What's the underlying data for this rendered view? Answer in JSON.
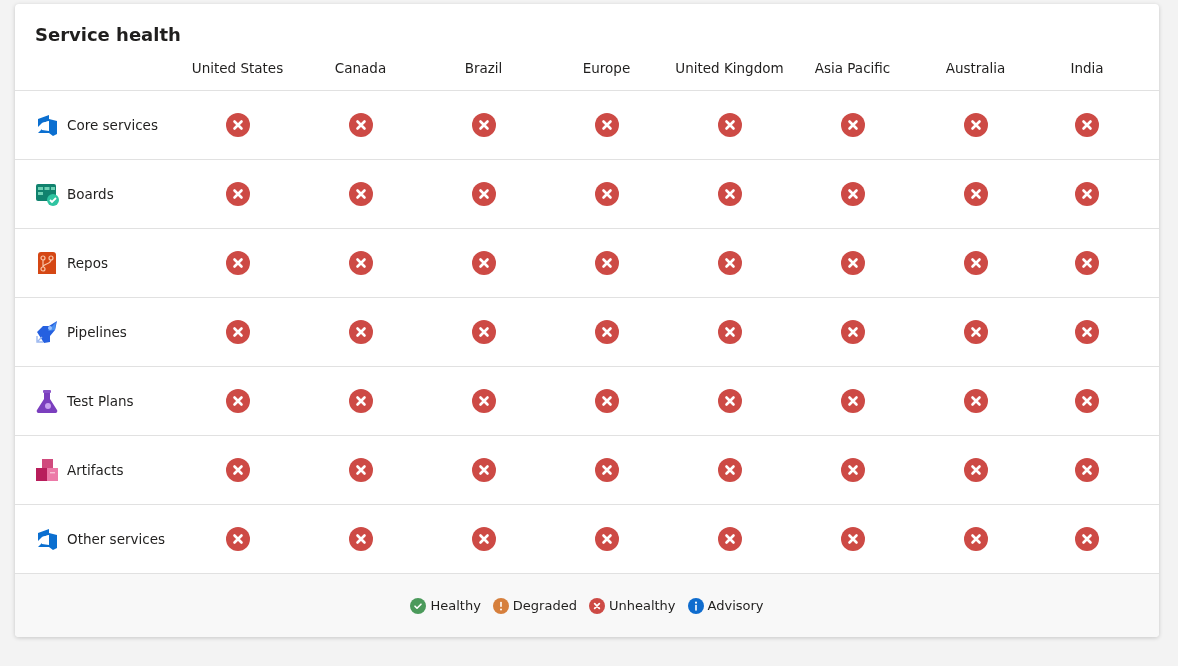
{
  "title": "Service health",
  "regions": [
    "United States",
    "Canada",
    "Brazil",
    "Europe",
    "United Kingdom",
    "Asia Pacific",
    "Australia",
    "India"
  ],
  "services": [
    {
      "name": "Core services",
      "kind": "azure",
      "statuses": [
        {
          "kind": "unhealthy"
        },
        {
          "kind": "unhealthy"
        },
        {
          "kind": "unhealthy"
        },
        {
          "kind": "unhealthy"
        },
        {
          "kind": "unhealthy"
        },
        {
          "kind": "unhealthy"
        },
        {
          "kind": "unhealthy"
        },
        {
          "kind": "unhealthy"
        }
      ]
    },
    {
      "name": "Boards",
      "kind": "boards",
      "statuses": [
        {
          "kind": "unhealthy"
        },
        {
          "kind": "unhealthy"
        },
        {
          "kind": "unhealthy"
        },
        {
          "kind": "unhealthy"
        },
        {
          "kind": "unhealthy"
        },
        {
          "kind": "unhealthy"
        },
        {
          "kind": "unhealthy"
        },
        {
          "kind": "unhealthy"
        }
      ]
    },
    {
      "name": "Repos",
      "kind": "repos",
      "statuses": [
        {
          "kind": "unhealthy"
        },
        {
          "kind": "unhealthy"
        },
        {
          "kind": "unhealthy"
        },
        {
          "kind": "unhealthy"
        },
        {
          "kind": "unhealthy"
        },
        {
          "kind": "unhealthy"
        },
        {
          "kind": "unhealthy"
        },
        {
          "kind": "unhealthy"
        }
      ]
    },
    {
      "name": "Pipelines",
      "kind": "pipelines",
      "statuses": [
        {
          "kind": "unhealthy"
        },
        {
          "kind": "unhealthy"
        },
        {
          "kind": "unhealthy"
        },
        {
          "kind": "unhealthy"
        },
        {
          "kind": "unhealthy"
        },
        {
          "kind": "unhealthy"
        },
        {
          "kind": "unhealthy"
        },
        {
          "kind": "unhealthy"
        }
      ]
    },
    {
      "name": "Test Plans",
      "kind": "testplans",
      "statuses": [
        {
          "kind": "unhealthy"
        },
        {
          "kind": "unhealthy"
        },
        {
          "kind": "unhealthy"
        },
        {
          "kind": "unhealthy"
        },
        {
          "kind": "unhealthy"
        },
        {
          "kind": "unhealthy"
        },
        {
          "kind": "unhealthy"
        },
        {
          "kind": "unhealthy"
        }
      ]
    },
    {
      "name": "Artifacts",
      "kind": "artifacts",
      "statuses": [
        {
          "kind": "unhealthy"
        },
        {
          "kind": "unhealthy"
        },
        {
          "kind": "unhealthy"
        },
        {
          "kind": "unhealthy"
        },
        {
          "kind": "unhealthy"
        },
        {
          "kind": "unhealthy"
        },
        {
          "kind": "unhealthy"
        },
        {
          "kind": "unhealthy"
        }
      ]
    },
    {
      "name": "Other services",
      "kind": "azure",
      "statuses": [
        {
          "kind": "unhealthy"
        },
        {
          "kind": "unhealthy"
        },
        {
          "kind": "unhealthy"
        },
        {
          "kind": "unhealthy"
        },
        {
          "kind": "unhealthy"
        },
        {
          "kind": "unhealthy"
        },
        {
          "kind": "unhealthy"
        },
        {
          "kind": "unhealthy"
        }
      ]
    }
  ],
  "legend": [
    {
      "label": "Healthy",
      "kind": "healthy"
    },
    {
      "label": "Degraded",
      "kind": "degraded"
    },
    {
      "label": "Unhealthy",
      "kind": "unhealthy"
    },
    {
      "label": "Advisory",
      "kind": "advisory"
    }
  ]
}
